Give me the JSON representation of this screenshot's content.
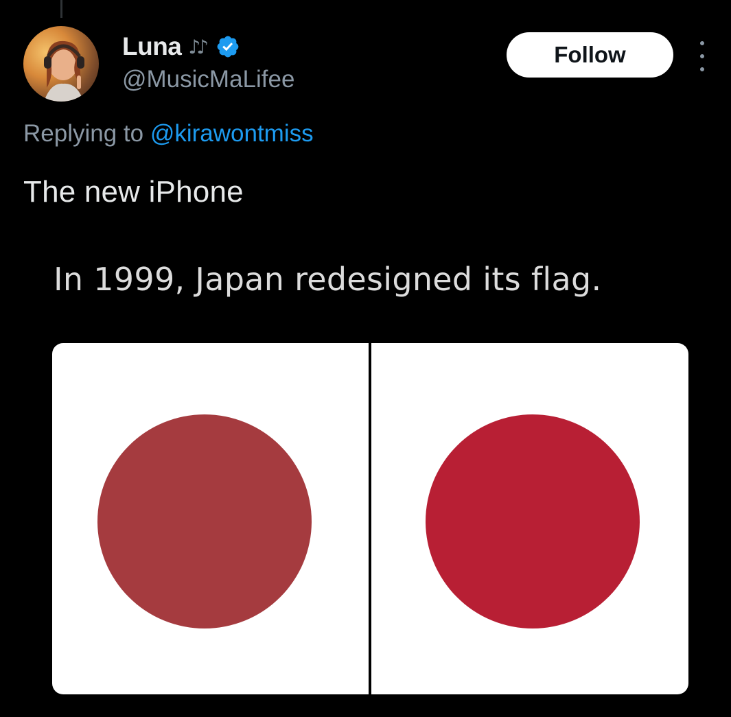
{
  "author": {
    "display_name": "Luna",
    "name_emoji": "♪♪",
    "verified": true,
    "handle": "@MusicMaLifee",
    "avatar_icon": "avatar-woman-headphones"
  },
  "actions": {
    "follow_label": "Follow",
    "more_icon": "more-vertical-icon"
  },
  "reply": {
    "prefix": "Replying to ",
    "target": "@kirawontmiss"
  },
  "tweet": {
    "text": "The new iPhone"
  },
  "media": {
    "caption": "In 1999, Japan redesigned its flag.",
    "flags": [
      {
        "disc_color": "#a53b3f"
      },
      {
        "disc_color": "#b81f34"
      }
    ]
  },
  "colors": {
    "background": "#000000",
    "text_primary": "#e7e9ea",
    "text_secondary": "#8b98a5",
    "link": "#1d9bf0",
    "verified": "#1d9bf0",
    "follow_bg": "#ffffff"
  }
}
